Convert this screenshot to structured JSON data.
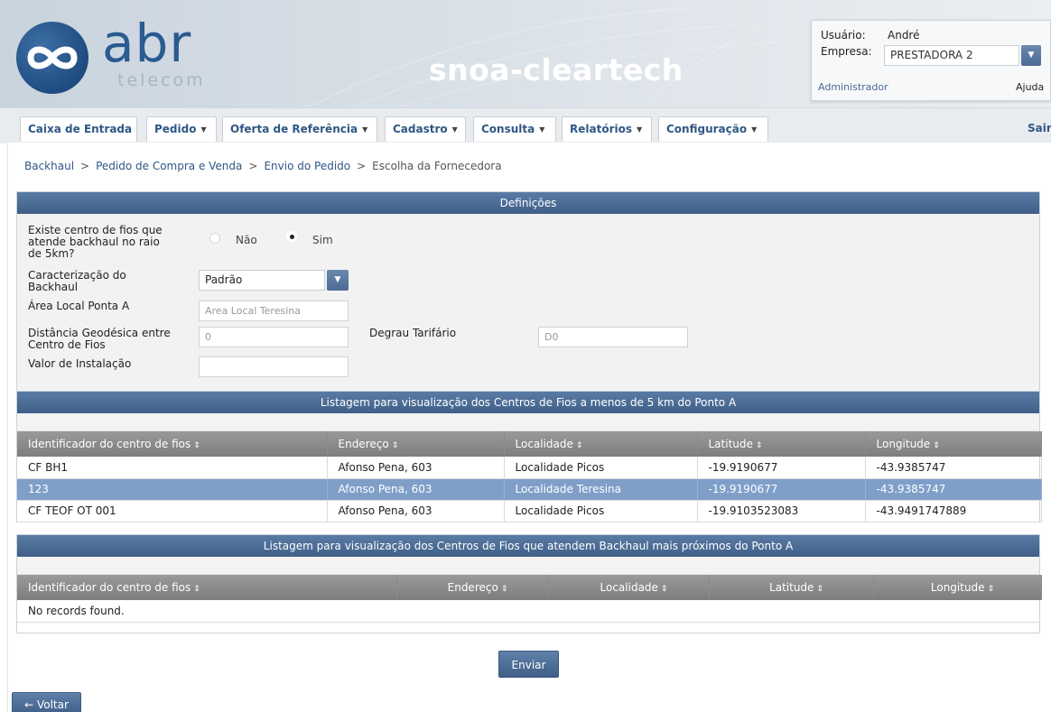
{
  "header": {
    "logo_text": "abr",
    "logo_sub": "telecom",
    "app_title": "snoa-cleartech"
  },
  "userbox": {
    "user_label": "Usuário:",
    "user_value": "André",
    "company_label": "Empresa:",
    "company_value": "PRESTADORA 2",
    "role_link": "Administrador",
    "help_link": "Ajuda"
  },
  "menu": {
    "items": [
      {
        "label": "Caixa de Entrada",
        "dropdown": false
      },
      {
        "label": "Pedido",
        "dropdown": true
      },
      {
        "label": "Oferta de Referência",
        "dropdown": true
      },
      {
        "label": "Cadastro",
        "dropdown": true
      },
      {
        "label": "Consulta",
        "dropdown": true
      },
      {
        "label": "Relatórios",
        "dropdown": true
      },
      {
        "label": "Configuração",
        "dropdown": true
      }
    ],
    "exit_label": "Sair"
  },
  "breadcrumb": [
    "Backhaul",
    "Pedido de Compra e Venda",
    "Envio do Pedido",
    "Escolha da Fornecedora"
  ],
  "definitions": {
    "title": "Definições",
    "question_line1": "Existe centro de fios que",
    "question_line2": "atende backhaul no raio",
    "question_line3": "de 5km?",
    "radio_no": "Não",
    "radio_yes": "Sim",
    "selected": "Sim",
    "characterization_line1": "Caracterização do",
    "characterization_line2": "Backhaul",
    "characterization_value": "Padrão",
    "local_area_label": "Área Local Ponta A",
    "local_area_placeholder": "Area Local Teresina",
    "distance_line1": "Distância Geodésica entre",
    "distance_line2": "Centro de Fios",
    "distance_value": "0",
    "tariff_label": "Degrau Tarifário",
    "tariff_value": "D0",
    "install_label": "Valor de Instalação",
    "install_value": ""
  },
  "table1": {
    "title": "Listagem para visualização dos Centros de Fios a menos de 5 km do Ponto A",
    "columns": [
      "Identificador do centro de fios",
      "Endereço",
      "Localidade",
      "Latitude",
      "Longitude"
    ],
    "rows": [
      [
        "CF BH1",
        "Afonso Pena, 603",
        "Localidade Picos",
        "-19.9190677",
        "-43.9385747"
      ],
      [
        "123",
        "Afonso Pena, 603",
        "Localidade Teresina",
        "-19.9190677",
        "-43.9385747"
      ],
      [
        "CF TEOF OT 001",
        "Afonso Pena, 603",
        "Localidade Picos",
        "-19.9103523083",
        "-43.9491747889"
      ]
    ],
    "selected_row": 1
  },
  "table2": {
    "title": "Listagem para visualização dos Centros de Fios que atendem Backhaul mais próximos do Ponto A",
    "columns": [
      "Identificador do centro de fios",
      "Endereço",
      "Localidade",
      "Latitude",
      "Longitude"
    ],
    "empty_message": "No records found."
  },
  "actions": {
    "submit_label": "Enviar",
    "back_label": "← Voltar"
  },
  "colors": {
    "header_blue": "#3f5f88",
    "selected_row": "#7f9fc9",
    "link": "#2f5785"
  }
}
